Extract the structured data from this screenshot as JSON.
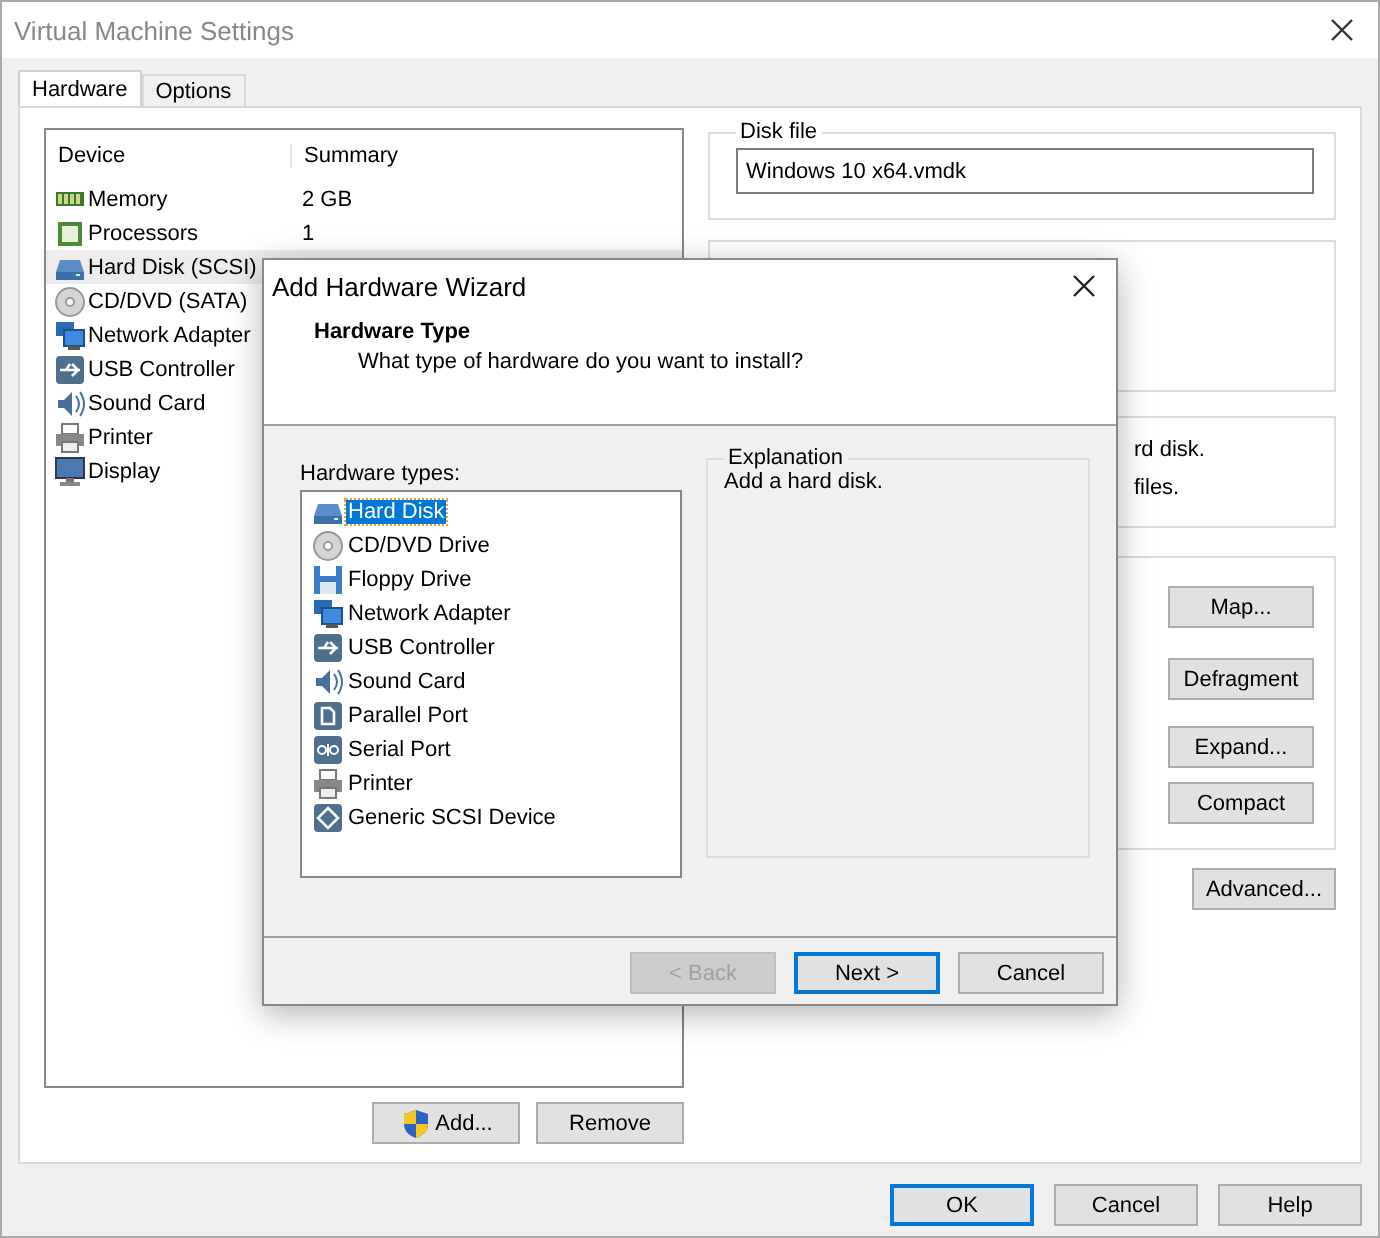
{
  "window": {
    "title": "Virtual Machine Settings"
  },
  "tabs": [
    {
      "label": "Hardware",
      "selected": true
    },
    {
      "label": "Options",
      "selected": false
    }
  ],
  "device_table": {
    "columns": [
      "Device",
      "Summary"
    ],
    "rows": [
      {
        "device": "Memory",
        "summary": "2 GB",
        "selected": false
      },
      {
        "device": "Processors",
        "summary": "1",
        "selected": false
      },
      {
        "device": "Hard Disk (SCSI)",
        "selected": true
      },
      {
        "device": "CD/DVD (SATA)",
        "selected": false
      },
      {
        "device": "Network Adapter",
        "selected": false
      },
      {
        "device": "USB Controller",
        "selected": false
      },
      {
        "device": "Sound Card",
        "selected": false
      },
      {
        "device": "Printer",
        "selected": false
      },
      {
        "device": "Display",
        "selected": false
      }
    ]
  },
  "device_buttons": [
    "Add...",
    "Remove"
  ],
  "disk_file": {
    "label": "Disk file",
    "value": "Windows 10 x64.vmdk"
  },
  "info_lines": [
    "rd disk.",
    "files."
  ],
  "utility_buttons": [
    "Map...",
    "Defragment",
    "Expand...",
    "Compact"
  ],
  "advanced_button": "Advanced...",
  "dialog_buttons": [
    "OK",
    "Cancel",
    "Help"
  ],
  "wizard": {
    "title": "Add Hardware Wizard",
    "heading": "Hardware Type",
    "subheading": "What type of hardware do you want to install?",
    "list_label": "Hardware types:",
    "items": [
      {
        "label": "Hard Disk",
        "selected": true
      },
      {
        "label": "CD/DVD Drive",
        "selected": false
      },
      {
        "label": "Floppy Drive",
        "selected": false
      },
      {
        "label": "Network Adapter",
        "selected": false
      },
      {
        "label": "USB Controller",
        "selected": false
      },
      {
        "label": "Sound Card",
        "selected": false
      },
      {
        "label": "Parallel Port",
        "selected": false
      },
      {
        "label": "Serial Port",
        "selected": false
      },
      {
        "label": "Printer",
        "selected": false
      },
      {
        "label": "Generic SCSI Device",
        "selected": false
      }
    ],
    "explanation": {
      "label": "Explanation",
      "text": "Add a hard disk."
    },
    "buttons": [
      {
        "label": "< Back",
        "disabled": true,
        "default": false
      },
      {
        "label": "Next >",
        "disabled": false,
        "default": true
      },
      {
        "label": "Cancel",
        "disabled": false,
        "default": false
      }
    ]
  }
}
